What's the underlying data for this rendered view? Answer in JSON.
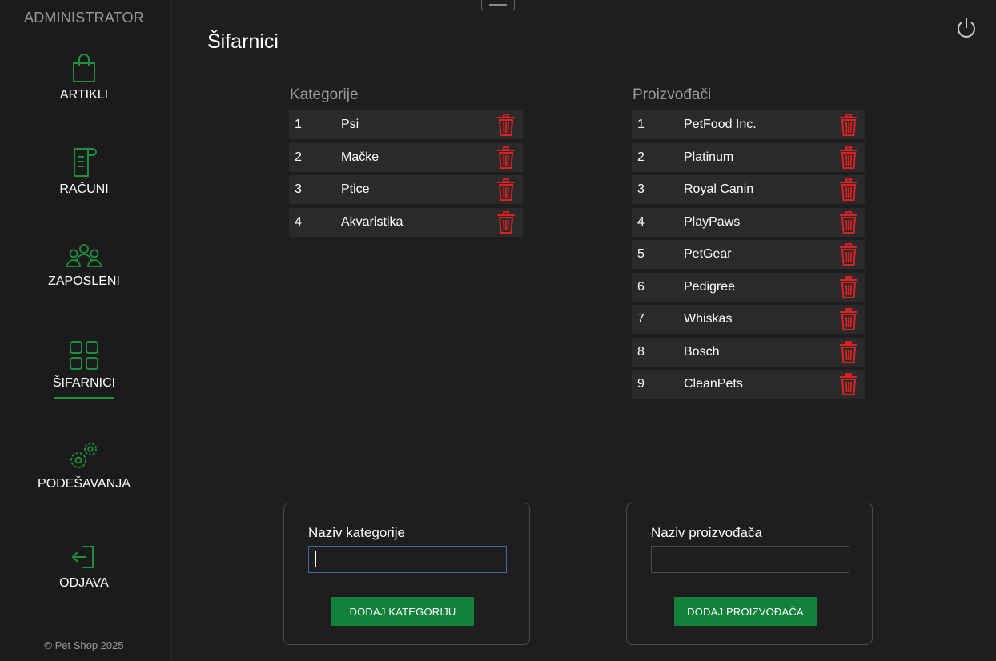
{
  "sidebar": {
    "title": "ADMINISTRATOR",
    "items": [
      {
        "label": "ARTIKLI",
        "icon": "shopping-bag-icon"
      },
      {
        "label": "RAČUNI",
        "icon": "receipt-icon"
      },
      {
        "label": "ZAPOSLENI",
        "icon": "users-icon"
      },
      {
        "label": "ŠIFARNICI",
        "icon": "grid-icon",
        "active": true
      },
      {
        "label": "PODEŠAVANJA",
        "icon": "gears-icon"
      },
      {
        "label": "ODJAVA",
        "icon": "logout-icon"
      }
    ],
    "copyright": "© Pet Shop 2025"
  },
  "page": {
    "title": "Šifarnici"
  },
  "categories": {
    "header": "Kategorije",
    "rows": [
      {
        "id": "1",
        "name": "Psi"
      },
      {
        "id": "2",
        "name": "Mačke"
      },
      {
        "id": "3",
        "name": "Ptice"
      },
      {
        "id": "4",
        "name": "Akvaristika"
      }
    ]
  },
  "manufacturers": {
    "header": "Proizvođači",
    "rows": [
      {
        "id": "1",
        "name": "PetFood Inc."
      },
      {
        "id": "2",
        "name": "Platinum"
      },
      {
        "id": "3",
        "name": "Royal Canin"
      },
      {
        "id": "4",
        "name": "PlayPaws"
      },
      {
        "id": "5",
        "name": "PetGear"
      },
      {
        "id": "6",
        "name": "Pedigree"
      },
      {
        "id": "7",
        "name": "Whiskas"
      },
      {
        "id": "8",
        "name": "Bosch"
      },
      {
        "id": "9",
        "name": "CleanPets"
      }
    ]
  },
  "category_form": {
    "label": "Naziv kategorije",
    "value": "",
    "button": "DODAJ KATEGORIJU"
  },
  "manufacturer_form": {
    "label": "Naziv proizvođača",
    "value": "",
    "button": "DODAJ PROIZVOĐAČA"
  },
  "colors": {
    "accent": "#1e8f3e",
    "button": "#12813a",
    "delete": "#e02020",
    "background": "#1e1e1e",
    "row": "#2a2a2a"
  }
}
